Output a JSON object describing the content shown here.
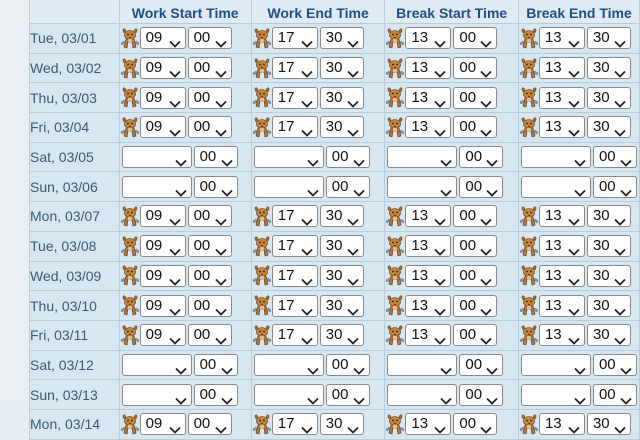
{
  "headers": {
    "date": "",
    "work_start": "Work Start Time",
    "work_end": "Work End Time",
    "break_start": "Break Start Time",
    "break_end": "Break End Time"
  },
  "icons": {
    "select_arrow": "chevron-down-icon",
    "row_decoration": "cat-icon"
  },
  "rows": [
    {
      "date": "Tue, 03/01",
      "ws_h": "09",
      "ws_m": "00",
      "we_h": "17",
      "we_m": "30",
      "bs_h": "13",
      "bs_m": "00",
      "be_h": "13",
      "be_m": "30"
    },
    {
      "date": "Wed, 03/02",
      "ws_h": "09",
      "ws_m": "00",
      "we_h": "17",
      "we_m": "30",
      "bs_h": "13",
      "bs_m": "00",
      "be_h": "13",
      "be_m": "30"
    },
    {
      "date": "Thu, 03/03",
      "ws_h": "09",
      "ws_m": "00",
      "we_h": "17",
      "we_m": "30",
      "bs_h": "13",
      "bs_m": "00",
      "be_h": "13",
      "be_m": "30"
    },
    {
      "date": "Fri, 03/04",
      "ws_h": "09",
      "ws_m": "00",
      "we_h": "17",
      "we_m": "30",
      "bs_h": "13",
      "bs_m": "00",
      "be_h": "13",
      "be_m": "30"
    },
    {
      "date": "Sat, 03/05",
      "ws_h": "",
      "ws_m": "00",
      "we_h": "",
      "we_m": "00",
      "bs_h": "",
      "bs_m": "00",
      "be_h": "",
      "be_m": "00"
    },
    {
      "date": "Sun, 03/06",
      "ws_h": "",
      "ws_m": "00",
      "we_h": "",
      "we_m": "00",
      "bs_h": "",
      "bs_m": "00",
      "be_h": "",
      "be_m": "00"
    },
    {
      "date": "Mon, 03/07",
      "ws_h": "09",
      "ws_m": "00",
      "we_h": "17",
      "we_m": "30",
      "bs_h": "13",
      "bs_m": "00",
      "be_h": "13",
      "be_m": "30"
    },
    {
      "date": "Tue, 03/08",
      "ws_h": "09",
      "ws_m": "00",
      "we_h": "17",
      "we_m": "30",
      "bs_h": "13",
      "bs_m": "00",
      "be_h": "13",
      "be_m": "30"
    },
    {
      "date": "Wed, 03/09",
      "ws_h": "09",
      "ws_m": "00",
      "we_h": "17",
      "we_m": "30",
      "bs_h": "13",
      "bs_m": "00",
      "be_h": "13",
      "be_m": "30"
    },
    {
      "date": "Thu, 03/10",
      "ws_h": "09",
      "ws_m": "00",
      "we_h": "17",
      "we_m": "30",
      "bs_h": "13",
      "bs_m": "00",
      "be_h": "13",
      "be_m": "30"
    },
    {
      "date": "Fri, 03/11",
      "ws_h": "09",
      "ws_m": "00",
      "we_h": "17",
      "we_m": "30",
      "bs_h": "13",
      "bs_m": "00",
      "be_h": "13",
      "be_m": "30"
    },
    {
      "date": "Sat, 03/12",
      "ws_h": "",
      "ws_m": "00",
      "we_h": "",
      "we_m": "00",
      "bs_h": "",
      "bs_m": "00",
      "be_h": "",
      "be_m": "00"
    },
    {
      "date": "Sun, 03/13",
      "ws_h": "",
      "ws_m": "00",
      "we_h": "",
      "we_m": "00",
      "bs_h": "",
      "bs_m": "00",
      "be_h": "",
      "be_m": "00"
    },
    {
      "date": "Mon, 03/14",
      "ws_h": "09",
      "ws_m": "00",
      "we_h": "17",
      "we_m": "30",
      "bs_h": "13",
      "bs_m": "00",
      "be_h": "13",
      "be_m": "30"
    }
  ]
}
